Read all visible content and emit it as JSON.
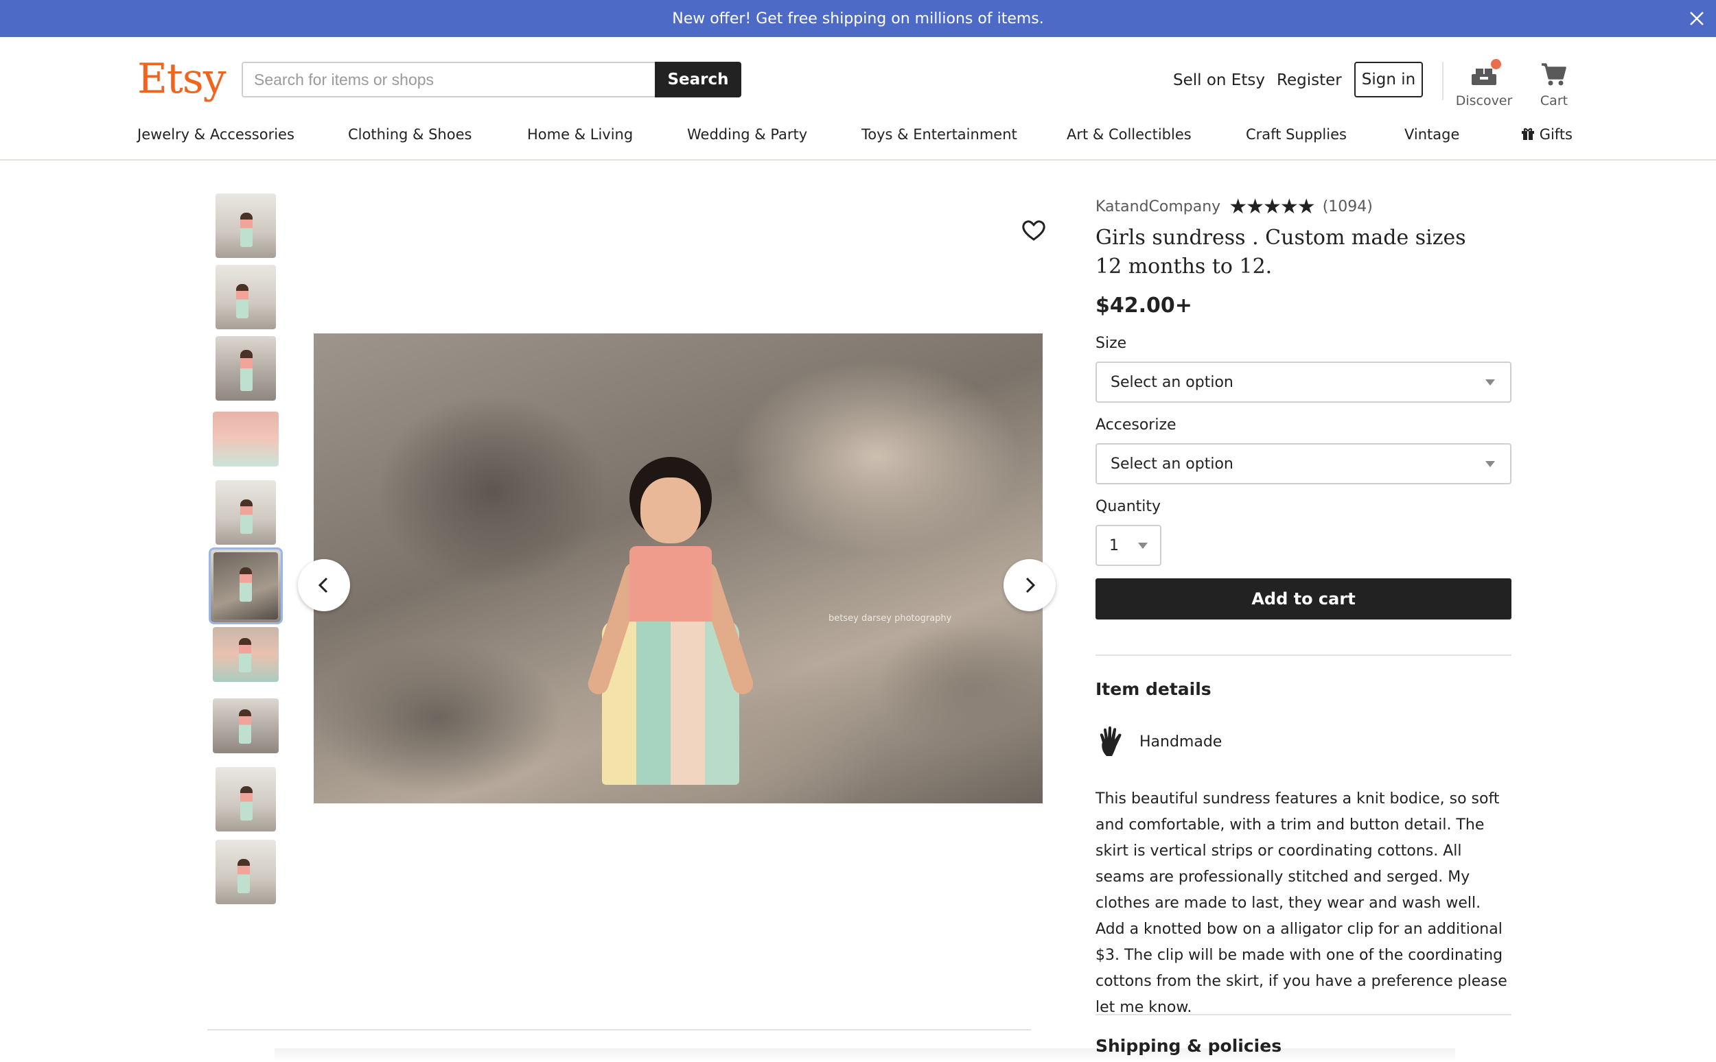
{
  "banner": {
    "text": "New offer! Get free shipping on millions of items."
  },
  "header": {
    "logo": "Etsy",
    "search": {
      "placeholder": "Search for items or shops",
      "value": "",
      "button_label": "Search"
    },
    "links": {
      "sell": "Sell on Etsy",
      "register": "Register",
      "sign_in": "Sign in"
    },
    "icons": [
      {
        "name": "discover-icon",
        "label": "Discover"
      },
      {
        "name": "cart-icon",
        "label": "Cart"
      }
    ]
  },
  "categories": [
    "Jewelry & Accessories",
    "Clothing & Shoes",
    "Home & Living",
    "Wedding & Party",
    "Toys & Entertainment",
    "Art & Collectibles",
    "Craft Supplies",
    "Vintage",
    "Gifts"
  ],
  "gallery": {
    "thumbnail_count": 10,
    "selected_index": 5,
    "watermark": "betsey darsey photography"
  },
  "product": {
    "shop_name": "KatandCompany",
    "rating": 5,
    "review_count": "(1094)",
    "title": "Girls sundress . Custom made sizes 12 months to 12.",
    "price": "$42.00+",
    "size": {
      "label": "Size",
      "value": "Select an option"
    },
    "accessorize": {
      "label": "Accesorize",
      "value": "Select an option"
    },
    "quantity": {
      "label": "Quantity",
      "value": "1"
    },
    "add_to_cart": "Add to cart",
    "details": {
      "heading": "Item details",
      "handmade": "Handmade",
      "description": "This beautiful sundress features a knit bodice, so soft and comfortable, with a trim and button detail. The skirt is vertical strips or coordinating cottons. All seams are professionally stitched and serged. My clothes are made to last, they wear and wash well. Add a knotted bow on a alligator clip for an additional $3. The clip will be made with one of the coordinating cottons from the skirt, if you have a preference please let me know."
    },
    "shipping_heading": "Shipping & policies"
  },
  "colors": {
    "brand": "#f1641e",
    "banner": "#4d6bc6",
    "button": "#222222",
    "selected_thumb": "#98b6e6"
  }
}
